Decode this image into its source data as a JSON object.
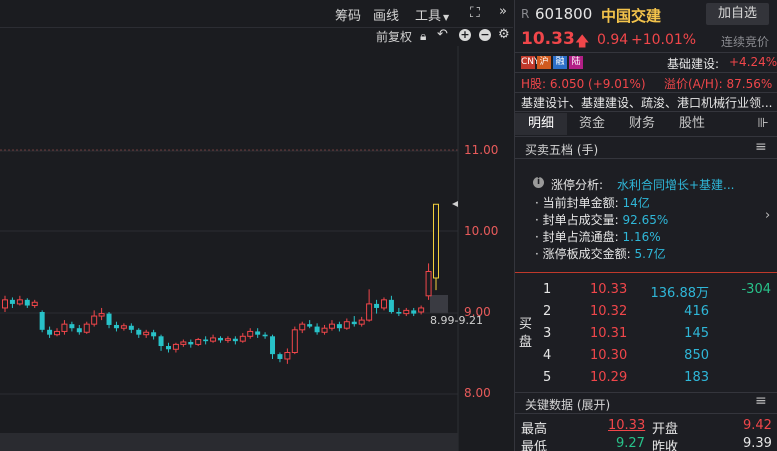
{
  "toolbar": {
    "chips_label": "筹码",
    "draw_label": "画线",
    "tools_label": "工具",
    "adjust_label": "前复权"
  },
  "chart": {
    "price_labels": [
      "11.00",
      "10.00",
      "9.00",
      "8.00"
    ],
    "range_label": "8.99-9.21",
    "colors": {
      "up": "#f0464a",
      "down": "#28c2c8",
      "limit": "#f3d03c"
    }
  },
  "chart_data": {
    "type": "candlestick",
    "ylim": [
      7.6,
      11.7
    ],
    "y_ticks": [
      11.0,
      10.0,
      9.0,
      8.0
    ],
    "candles": [
      {
        "o": 9.05,
        "c": 9.15,
        "h": 9.2,
        "l": 9.0
      },
      {
        "o": 9.15,
        "c": 9.1,
        "h": 9.18,
        "l": 9.05
      },
      {
        "o": 9.1,
        "c": 9.15,
        "h": 9.2,
        "l": 9.08
      },
      {
        "o": 9.15,
        "c": 9.08,
        "h": 9.17,
        "l": 9.05
      },
      {
        "o": 9.08,
        "c": 9.12,
        "h": 9.15,
        "l": 9.05
      },
      {
        "o": 9.0,
        "c": 8.78,
        "h": 9.02,
        "l": 8.75
      },
      {
        "o": 8.78,
        "c": 8.72,
        "h": 8.82,
        "l": 8.68
      },
      {
        "o": 8.72,
        "c": 8.76,
        "h": 8.8,
        "l": 8.7
      },
      {
        "o": 8.76,
        "c": 8.85,
        "h": 8.9,
        "l": 8.72
      },
      {
        "o": 8.85,
        "c": 8.8,
        "h": 8.88,
        "l": 8.76
      },
      {
        "o": 8.8,
        "c": 8.75,
        "h": 8.84,
        "l": 8.72
      },
      {
        "o": 8.75,
        "c": 8.85,
        "h": 8.88,
        "l": 8.73
      },
      {
        "o": 8.85,
        "c": 8.95,
        "h": 9.02,
        "l": 8.82
      },
      {
        "o": 8.95,
        "c": 8.98,
        "h": 9.05,
        "l": 8.9
      },
      {
        "o": 8.98,
        "c": 8.84,
        "h": 9.0,
        "l": 8.8
      },
      {
        "o": 8.84,
        "c": 8.8,
        "h": 8.88,
        "l": 8.76
      },
      {
        "o": 8.8,
        "c": 8.83,
        "h": 8.86,
        "l": 8.77
      },
      {
        "o": 8.83,
        "c": 8.78,
        "h": 8.86,
        "l": 8.74
      },
      {
        "o": 8.78,
        "c": 8.72,
        "h": 8.8,
        "l": 8.68
      },
      {
        "o": 8.72,
        "c": 8.75,
        "h": 8.78,
        "l": 8.68
      },
      {
        "o": 8.75,
        "c": 8.7,
        "h": 8.78,
        "l": 8.66
      },
      {
        "o": 8.7,
        "c": 8.58,
        "h": 8.72,
        "l": 8.52
      },
      {
        "o": 8.58,
        "c": 8.54,
        "h": 8.62,
        "l": 8.5
      },
      {
        "o": 8.54,
        "c": 8.6,
        "h": 8.62,
        "l": 8.5
      },
      {
        "o": 8.6,
        "c": 8.63,
        "h": 8.66,
        "l": 8.57
      },
      {
        "o": 8.63,
        "c": 8.6,
        "h": 8.66,
        "l": 8.56
      },
      {
        "o": 8.6,
        "c": 8.66,
        "h": 8.68,
        "l": 8.58
      },
      {
        "o": 8.66,
        "c": 8.64,
        "h": 8.7,
        "l": 8.6
      },
      {
        "o": 8.64,
        "c": 8.68,
        "h": 8.72,
        "l": 8.62
      },
      {
        "o": 8.68,
        "c": 8.65,
        "h": 8.7,
        "l": 8.62
      },
      {
        "o": 8.65,
        "c": 8.67,
        "h": 8.7,
        "l": 8.62
      },
      {
        "o": 8.67,
        "c": 8.64,
        "h": 8.7,
        "l": 8.6
      },
      {
        "o": 8.64,
        "c": 8.7,
        "h": 8.74,
        "l": 8.62
      },
      {
        "o": 8.7,
        "c": 8.76,
        "h": 8.8,
        "l": 8.67
      },
      {
        "o": 8.76,
        "c": 8.72,
        "h": 8.8,
        "l": 8.68
      },
      {
        "o": 8.72,
        "c": 8.7,
        "h": 8.75,
        "l": 8.67
      },
      {
        "o": 8.7,
        "c": 8.48,
        "h": 8.72,
        "l": 8.42
      },
      {
        "o": 8.48,
        "c": 8.42,
        "h": 8.5,
        "l": 8.38
      },
      {
        "o": 8.42,
        "c": 8.5,
        "h": 8.55,
        "l": 8.36
      },
      {
        "o": 8.5,
        "c": 8.78,
        "h": 8.82,
        "l": 8.48
      },
      {
        "o": 8.78,
        "c": 8.85,
        "h": 8.88,
        "l": 8.74
      },
      {
        "o": 8.85,
        "c": 8.82,
        "h": 8.9,
        "l": 8.8
      },
      {
        "o": 8.82,
        "c": 8.75,
        "h": 8.86,
        "l": 8.72
      },
      {
        "o": 8.75,
        "c": 8.8,
        "h": 8.84,
        "l": 8.72
      },
      {
        "o": 8.8,
        "c": 8.85,
        "h": 8.9,
        "l": 8.77
      },
      {
        "o": 8.85,
        "c": 8.8,
        "h": 8.88,
        "l": 8.76
      },
      {
        "o": 8.8,
        "c": 8.88,
        "h": 8.92,
        "l": 8.78
      },
      {
        "o": 8.88,
        "c": 8.85,
        "h": 8.95,
        "l": 8.82
      },
      {
        "o": 8.85,
        "c": 8.9,
        "h": 8.94,
        "l": 8.82
      },
      {
        "o": 8.9,
        "c": 9.1,
        "h": 9.28,
        "l": 8.88
      },
      {
        "o": 9.1,
        "c": 9.05,
        "h": 9.15,
        "l": 8.98
      },
      {
        "o": 9.05,
        "c": 9.15,
        "h": 9.18,
        "l": 9.02
      },
      {
        "o": 9.15,
        "c": 9.0,
        "h": 9.2,
        "l": 8.98
      },
      {
        "o": 9.0,
        "c": 8.98,
        "h": 9.05,
        "l": 8.95
      },
      {
        "o": 8.98,
        "c": 9.02,
        "h": 9.05,
        "l": 8.95
      },
      {
        "o": 9.02,
        "c": 8.98,
        "h": 9.05,
        "l": 8.95
      },
      {
        "o": 9.0,
        "c": 9.05,
        "h": 9.08,
        "l": 8.97
      },
      {
        "o": 9.2,
        "c": 9.5,
        "h": 9.6,
        "l": 9.15
      },
      {
        "o": 9.42,
        "c": 10.33,
        "h": 10.33,
        "l": 9.27
      }
    ]
  },
  "stock": {
    "market_badge": "R",
    "code": "601800",
    "name": "中国交建",
    "add_watch": "加自选",
    "price": "10.33",
    "change": "0.94",
    "change_pct": "+10.01%",
    "status": "连续竞价",
    "tags": [
      "CNY",
      "沪",
      "融",
      "陆"
    ],
    "sector_label": "基础建设:",
    "sector_pct": "+4.24%",
    "h_share": "H股: 6.050 (+9.01%)",
    "premium": "溢价(A/H): 87.56%",
    "business": "基建设计、基建建设、疏浚、港口机械行业领..."
  },
  "tabs": [
    "明细",
    "资金",
    "财务",
    "股性"
  ],
  "tab_more": "⊪",
  "order_book_title": "买卖五档 (手)",
  "limit_up": {
    "title": "涨停分析:",
    "reason": "水利合同增长+基建...",
    "lines": [
      {
        "label": "当前封单金额:",
        "value": "14亿"
      },
      {
        "label": "封单占成交量:",
        "value": "92.65%"
      },
      {
        "label": "封单占流通盘:",
        "value": "1.16%"
      },
      {
        "label": "涨停板成交金额:",
        "value": "5.7亿"
      }
    ]
  },
  "bids": {
    "side_label": "买盘",
    "rows": [
      {
        "level": "1",
        "price": "10.33",
        "volume": "136.88万",
        "delta": "-304"
      },
      {
        "level": "2",
        "price": "10.32",
        "volume": "416",
        "delta": ""
      },
      {
        "level": "3",
        "price": "10.31",
        "volume": "145",
        "delta": ""
      },
      {
        "level": "4",
        "price": "10.30",
        "volume": "850",
        "delta": ""
      },
      {
        "level": "5",
        "price": "10.29",
        "volume": "183",
        "delta": ""
      }
    ]
  },
  "key_data": {
    "title": "关键数据 (展开)",
    "high_label": "最高",
    "high": "10.33",
    "open_label": "开盘",
    "open": "9.42",
    "low_label": "最低",
    "low": "9.27",
    "prev_close_label": "昨收",
    "prev_close": "9.39"
  }
}
